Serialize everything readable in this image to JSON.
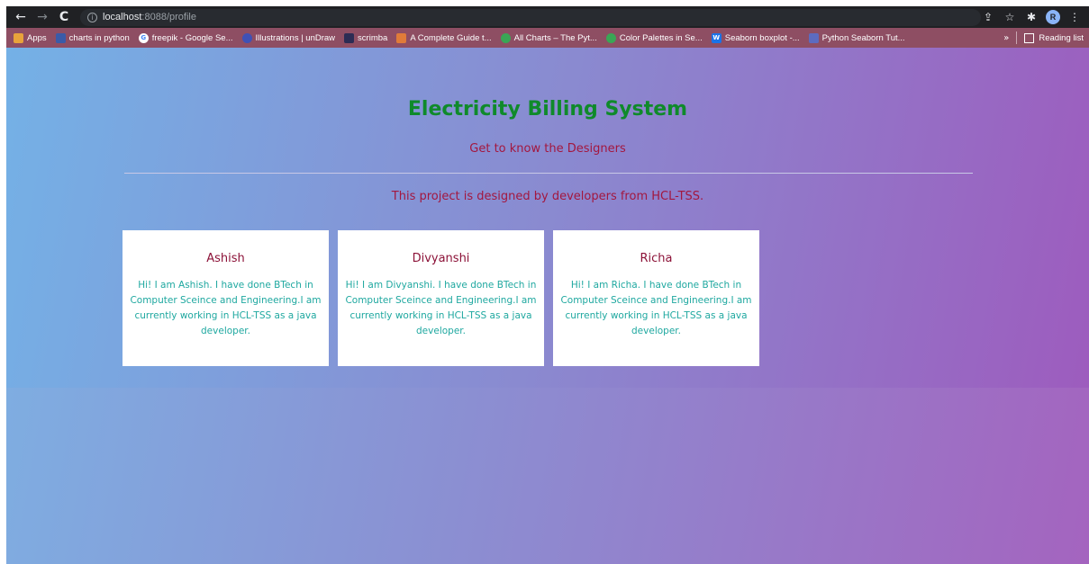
{
  "browser": {
    "url_host": "localhost",
    "url_rest": ":8088/profile",
    "profile_initial": "R"
  },
  "bookmarks": [
    {
      "label": "Apps",
      "icon": "apps-grid-icon",
      "color": "#e8a33b"
    },
    {
      "label": "charts in python",
      "icon": "site-icon",
      "color": "#3a5ba8"
    },
    {
      "label": "freepik - Google Se...",
      "icon": "google-icon",
      "color": "#ffffff"
    },
    {
      "label": "Illustrations | unDraw",
      "icon": "undraw-icon",
      "color": "#3f51b5"
    },
    {
      "label": "scrimba",
      "icon": "scrimba-icon",
      "color": "#2c2c54"
    },
    {
      "label": "A Complete Guide t...",
      "icon": "css-tricks-icon",
      "color": "#e07b39"
    },
    {
      "label": "All Charts – The Pyt...",
      "icon": "python-graph-icon",
      "color": "#3aa655"
    },
    {
      "label": "Color Palettes in Se...",
      "icon": "palette-icon",
      "color": "#3aa655"
    },
    {
      "label": "Seaborn boxplot -...",
      "icon": "w3-icon",
      "color": "#1a73e8"
    },
    {
      "label": "Python Seaborn Tut...",
      "icon": "list-icon",
      "color": "#5c6bc0"
    }
  ],
  "bookmarks_right": {
    "label": "Reading list",
    "overflow": "»"
  },
  "page": {
    "title": "Electricity Billing System",
    "subtitle": "Get to know the Designers",
    "intro": "This project is designed by developers from HCL-TSS."
  },
  "designers": [
    {
      "name": "Ashish",
      "bio": "Hi! I am Ashish. I have done BTech in Computer Sceince and Engineering.I am currently working in HCL-TSS as a java developer."
    },
    {
      "name": "Divyanshi",
      "bio": "Hi! I am Divyanshi. I have done BTech in Computer Sceince and Engineering.I am currently working in HCL-TSS as a java developer."
    },
    {
      "name": "Richa",
      "bio": "Hi! I am Richa. I have done BTech in Computer Sceince and Engineering.I am currently working in HCL-TSS as a java developer."
    }
  ],
  "colors": {
    "title": "#0f8a2a",
    "accent": "#a3173f",
    "card_name": "#8c1238",
    "card_text": "#1fa8a0"
  }
}
